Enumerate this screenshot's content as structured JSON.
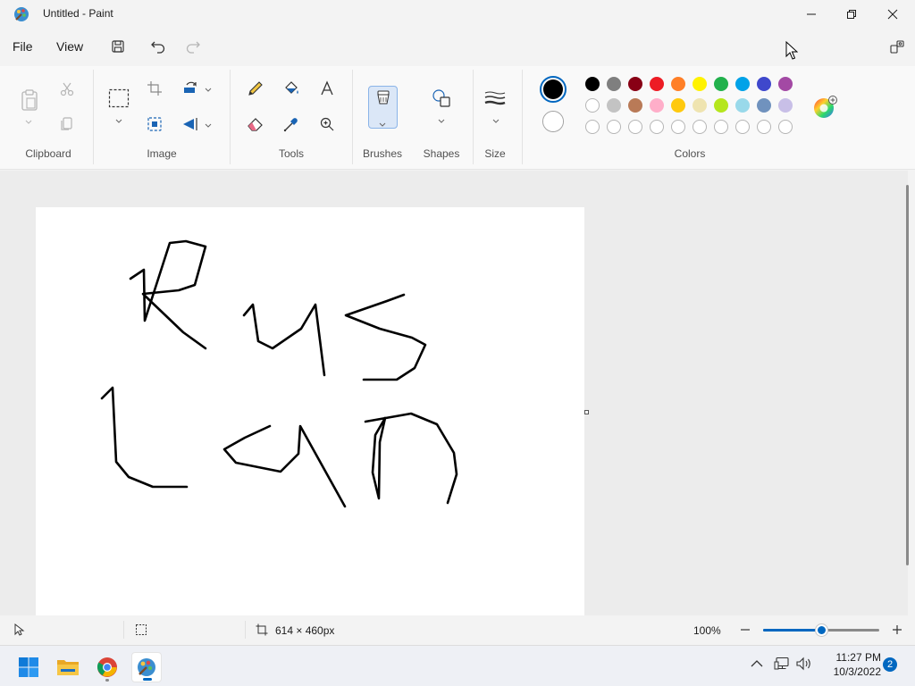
{
  "window": {
    "title": "Untitled - Paint"
  },
  "menu": {
    "file_label": "File",
    "view_label": "View"
  },
  "ribbon": {
    "groups": {
      "clipboard": "Clipboard",
      "image": "Image",
      "tools": "Tools",
      "brushes": "Brushes",
      "shapes": "Shapes",
      "size": "Size",
      "colors": "Colors"
    }
  },
  "colors": {
    "primary": "#000000",
    "secondary": "#ffffff",
    "palette_row1": [
      "#000000",
      "#7f7f7f",
      "#880015",
      "#ed1c24",
      "#ff7f27",
      "#fff200",
      "#22b14c",
      "#00a2e8",
      "#3f48cc",
      "#a349a4"
    ],
    "palette_row2": [
      "#ffffff",
      "#c3c3c3",
      "#b97a57",
      "#ffaec9",
      "#ffc90e",
      "#efe4b0",
      "#b5e61d",
      "#99d9ea",
      "#7092be",
      "#c8bfe7"
    ],
    "palette_row3": [
      "",
      "",
      "",
      "",
      "",
      "",
      "",
      "",
      "",
      ""
    ]
  },
  "status": {
    "canvas_size": "614 × 460px",
    "zoom": "100%",
    "zoom_level": 0.5
  },
  "taskbar": {
    "time": "11:27 PM",
    "date": "10/3/2022",
    "notification_count": "2"
  }
}
